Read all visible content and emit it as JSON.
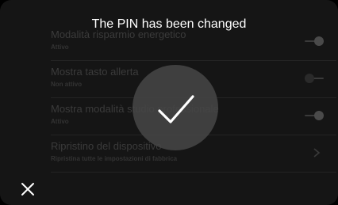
{
  "notification": {
    "message": "The PIN has been changed"
  },
  "settings": {
    "items": [
      {
        "title": "Modalità risparmio energetico",
        "status": "Attivo",
        "control": "toggle",
        "on": true
      },
      {
        "title": "Mostra tasto allerta",
        "status": "Non attivo",
        "control": "toggle",
        "on": false
      },
      {
        "title": "Mostra modalità studio professionale",
        "status": "Attivo",
        "control": "toggle",
        "on": true
      },
      {
        "title": "Ripristino del dispositivo",
        "status": "Ripristina tutte le impostazioni di fabbrica",
        "control": "chevron"
      }
    ]
  },
  "icons": {
    "success": "checkmark-icon",
    "close": "close-icon",
    "chevron": "chevron-right-icon"
  },
  "colors": {
    "background": "#151515",
    "overlay_circle": "#464646",
    "text": "#ffffff"
  }
}
